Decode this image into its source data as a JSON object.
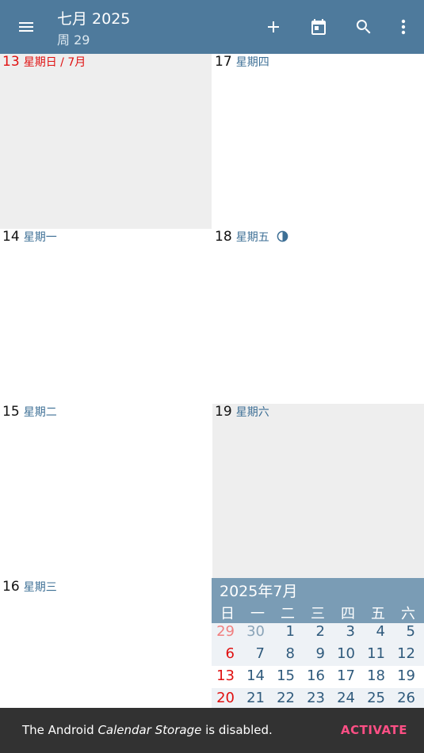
{
  "header": {
    "title": "七月 2025",
    "subtitle": "周 29"
  },
  "icons": {
    "menu": "menu-icon",
    "add": "add-icon",
    "today": "calendar-today-icon",
    "search": "search-icon",
    "overflow": "more-vert-icon"
  },
  "days": [
    {
      "num": "13",
      "name": "星期日 / 7月",
      "today": true
    },
    {
      "num": "17",
      "name": "星期四"
    },
    {
      "num": "14",
      "name": "星期一"
    },
    {
      "num": "18",
      "name": "星期五",
      "moon": "first-quarter-moon-icon"
    },
    {
      "num": "15",
      "name": "星期二"
    },
    {
      "num": "19",
      "name": "星期六"
    },
    {
      "num": "16",
      "name": "星期三"
    }
  ],
  "minical": {
    "title": "2025年7月",
    "weekdays": [
      "日",
      "一",
      "二",
      "三",
      "四",
      "五",
      "六"
    ],
    "weeks": [
      [
        "29",
        "30",
        "1",
        "2",
        "3",
        "4",
        "5"
      ],
      [
        "6",
        "7",
        "8",
        "9",
        "10",
        "11",
        "12"
      ],
      [
        "13",
        "14",
        "15",
        "16",
        "17",
        "18",
        "19"
      ],
      [
        "20",
        "21",
        "22",
        "23",
        "24",
        "25",
        "26"
      ]
    ]
  },
  "snackbar": {
    "prefix": "The Android ",
    "emphasis": "Calendar Storage",
    "suffix": " is disabled.",
    "action": "ACTIVATE"
  },
  "colors": {
    "appbar": "#4e7a9c",
    "today": "#e01010",
    "accent": "#ff4f85",
    "dayname": "#3d6f95"
  }
}
